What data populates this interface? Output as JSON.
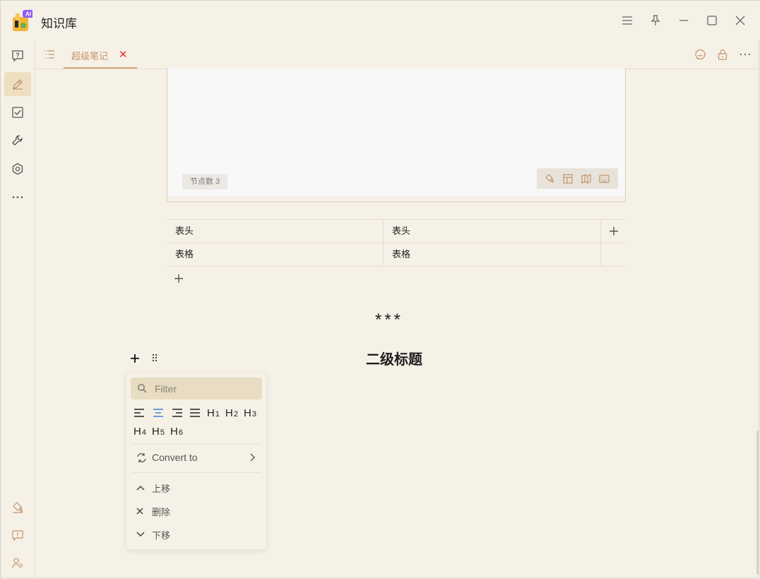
{
  "window": {
    "title": "知识库",
    "logo_badge": "AI"
  },
  "tab": {
    "label": "超级笔记",
    "close_glyph": "✕"
  },
  "mindmap": {
    "node_count": "节点数 3"
  },
  "table": {
    "rows": [
      [
        "表头",
        "表头"
      ],
      [
        "表格",
        "表格"
      ]
    ]
  },
  "divider": "***",
  "heading": "二级标题",
  "block_menu": {
    "filter_placeholder": "Filter",
    "heading_levels": [
      {
        "letter": "H",
        "num": "1"
      },
      {
        "letter": "H",
        "num": "2"
      },
      {
        "letter": "H",
        "num": "3"
      },
      {
        "letter": "H",
        "num": "4"
      },
      {
        "letter": "H",
        "num": "5"
      },
      {
        "letter": "H",
        "num": "6"
      }
    ],
    "convert_label": "Convert to",
    "move_up": "上移",
    "delete": "删除",
    "move_down": "下移"
  },
  "colors": {
    "accent": "#c2946a",
    "close_red": "#e0312c",
    "background": "#f6f1e7",
    "active_nav": "#eedfc2"
  }
}
